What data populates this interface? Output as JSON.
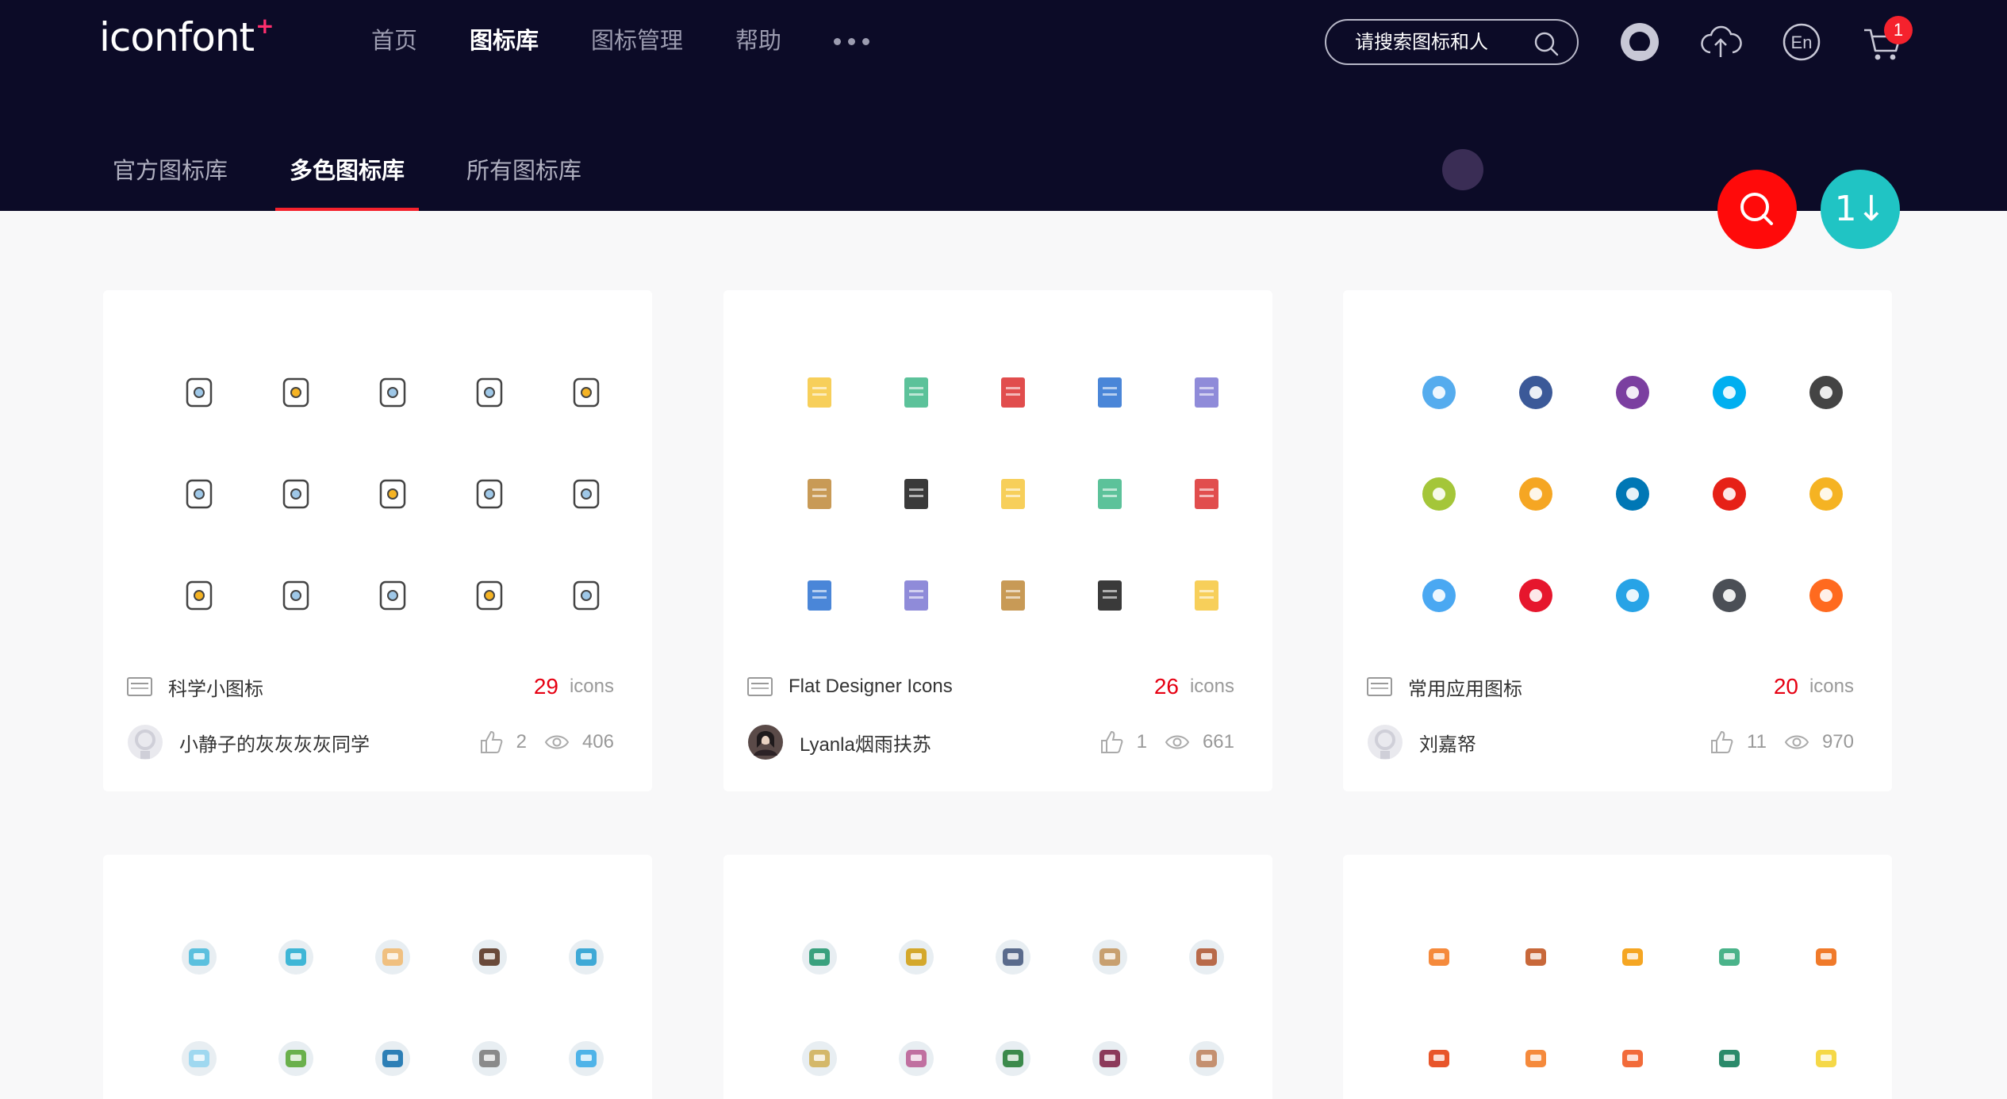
{
  "header": {
    "logo": "iconfont",
    "logo_plus": "+",
    "nav": [
      "首页",
      "图标库",
      "图标管理",
      "帮助"
    ],
    "nav_active_index": 1,
    "search_placeholder": "请搜索图标和人",
    "cart_count": "1",
    "lang_label": "En"
  },
  "subnav": {
    "tabs": [
      "官方图标库",
      "多色图标库",
      "所有图标库"
    ],
    "active_index": 1
  },
  "fab": {
    "sort_label": "1↓"
  },
  "cards": [
    {
      "name": "科学小图标",
      "count": "29",
      "unit": "icons",
      "author": "小静子的灰灰灰灰同学",
      "likes": "2",
      "views": "406",
      "icons": [
        "atom-icon",
        "flask-icon",
        "clipboard-chart-icon",
        "lightbulb-plant-icon",
        "molecule-cube-icon",
        "dna-icon",
        "molecule-icon",
        "glasses-icon",
        "globe-icon",
        "brain-head-icon",
        "head-gear-icon",
        "potion-flask-icon",
        "test-tube-icon",
        "magnet-icon",
        "magnifier-icon"
      ]
    },
    {
      "name": "Flat Designer Icons",
      "count": "26",
      "unit": "icons",
      "author": "Lyanla烟雨扶苏",
      "likes": "1",
      "views": "661",
      "icons": [
        "file-icon",
        "document-icon",
        "image-icon",
        "disc-icon",
        "phone-icon",
        "tag-icon",
        "gear-icon",
        "pdf-icon",
        "credit-card-icon",
        "clock-icon",
        "monitor-icon",
        "calendar-icon",
        "mail-icon",
        "clipboard-icon",
        "notebook-icon"
      ]
    },
    {
      "name": "常用应用图标",
      "count": "20",
      "unit": "icons",
      "author": "刘嘉帑",
      "likes": "11",
      "views": "970",
      "icons": [
        "twitter-icon",
        "facebook-icon",
        "yahoo-icon",
        "skype-icon",
        "google-plus-icon",
        "android-icon",
        "amazon-icon",
        "linkedin-icon",
        "youtube-icon",
        "star-badge-icon",
        "qq-icon",
        "weibo-icon",
        "pinterest-icon",
        "alipay-icon",
        "taobao-icon"
      ]
    },
    {
      "name": "",
      "icons": [
        "laptop-icon",
        "map-pin-globe-icon",
        "book-icon",
        "coffee-bowl-icon",
        "tablet-icon",
        "weather-icon",
        "landscape-icon",
        "music-wave-icon",
        "radio-icon",
        "cloud-game-icon"
      ]
    },
    {
      "name": "",
      "icons": [
        "money-icon",
        "calendar-circle-icon",
        "browser-window-icon",
        "person-desk-icon",
        "meeting-icon",
        "network-people-icon",
        "money-bag-icon",
        "card-circle-icon",
        "rocket-circle-icon",
        "id-card-icon"
      ]
    },
    {
      "name": "",
      "icons": [
        "stamp-icon",
        "hourglass-icon",
        "flower-pot-icon",
        "binoculars-icon",
        "cake-icon",
        "gramophone-icon",
        "cheese-icon",
        "ring-icon",
        "brush-icon",
        "bulb-icon"
      ]
    }
  ]
}
